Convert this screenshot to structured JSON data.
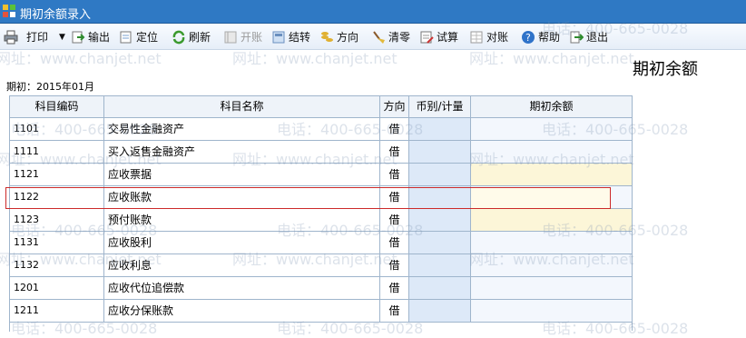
{
  "window": {
    "title": "期初余额录入"
  },
  "toolbar": {
    "print": "打印",
    "export": "输出",
    "locate": "定位",
    "refresh": "刷新",
    "open_account": "开账",
    "carry_over": "结转",
    "direction": "方向",
    "clear_zero": "清零",
    "trial_balance": "试算",
    "reconcile": "对账",
    "help": "帮助",
    "exit": "退出"
  },
  "heading": "期初余额",
  "period": "期初：2015年01月",
  "table": {
    "columns": [
      "科目编码",
      "科目名称",
      "方向",
      "币别/计量",
      "期初余额"
    ],
    "rows": [
      {
        "code": "1101",
        "name": "交易性金融资产",
        "dir": "借",
        "currency": "",
        "balance": ""
      },
      {
        "code": "1111",
        "name": "买入返售金融资产",
        "dir": "借",
        "currency": "",
        "balance": ""
      },
      {
        "code": "1121",
        "name": "应收票据",
        "dir": "借",
        "currency": "",
        "balance": ""
      },
      {
        "code": "1122",
        "name": "应收账款",
        "dir": "借",
        "currency": "",
        "balance": ""
      },
      {
        "code": "1123",
        "name": "预付账款",
        "dir": "借",
        "currency": "",
        "balance": ""
      },
      {
        "code": "1131",
        "name": "应收股利",
        "dir": "借",
        "currency": "",
        "balance": ""
      },
      {
        "code": "1132",
        "name": "应收利息",
        "dir": "借",
        "currency": "",
        "balance": ""
      },
      {
        "code": "1201",
        "name": "应收代位追偿款",
        "dir": "借",
        "currency": "",
        "balance": ""
      },
      {
        "code": "1211",
        "name": "应收分保账款",
        "dir": "借",
        "currency": "",
        "balance": ""
      }
    ]
  },
  "watermarks": {
    "phone": "电话：400-665-0028",
    "site": "网址：www.chanjet.net"
  },
  "colors": {
    "title_bar": "#2f79c4",
    "selection_border": "#cc2a2a",
    "editable_cell": "#fcf6d8"
  },
  "icons": [
    "app-grid-icon",
    "printer-icon",
    "export-icon",
    "locate-icon",
    "refresh-icon",
    "open-account-icon",
    "carry-over-icon",
    "direction-icon",
    "broom-icon",
    "trial-balance-icon",
    "reconcile-icon",
    "help-icon",
    "exit-icon"
  ]
}
